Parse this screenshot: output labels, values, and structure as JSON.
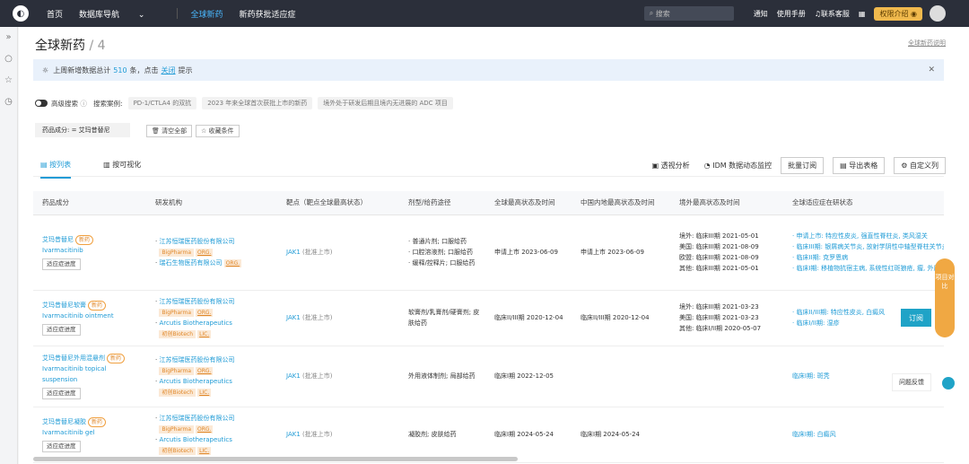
{
  "nav": {
    "home": "首页",
    "db_nav": "数据库导航",
    "global_new_drug": "全球新药",
    "new_drug_approval": "新药获批适应症"
  },
  "top": {
    "search_placeholder": "搜索",
    "notice": "通知",
    "manual": "使用手册",
    "contact": "联系客服",
    "perm": "权限介绍"
  },
  "page": {
    "title": "全球新药",
    "count": "/ 4",
    "help_link": "全球新药说明"
  },
  "banner": {
    "text_pre": "上周新增数据总计",
    "num": "510",
    "text_mid": "条，点击",
    "link": "关闭",
    "text_post": "提示"
  },
  "adv": {
    "label": "高级搜索",
    "cases_label": "搜索案例:",
    "chip1": "PD-1/CTLA4 的双抗",
    "chip2": "2023 年来全球首次获批上市的新药",
    "chip3": "境外处于研发后期且境内无进展的 ADC 项目"
  },
  "filter": {
    "text": "药品成分: = 艾玛昔替尼",
    "clear": "清空全部",
    "save": "收藏条件"
  },
  "tabs": {
    "list": "按列表",
    "visual": "按可视化"
  },
  "tools": {
    "analysis": "透视分析",
    "idm": "IDM 数据动态监控",
    "batch": "批量订阅",
    "export": "导出表格",
    "custom": "自定义列"
  },
  "columns": [
    "药品成分",
    "研发机构",
    "靶点（靶点全球最高状态）",
    "剂型/给药途径",
    "全球最高状态及时间",
    "中国内地最高状态及时间",
    "境外最高状态及时间",
    "全球适应症在研状态"
  ],
  "rows": [
    {
      "name": "艾玛昔替尼",
      "en": "Ivarmacitinib",
      "tag": "新药",
      "btn": "适应症进度",
      "org1": "江苏恒瑞医药股份有限公司",
      "o1a": "BigPharma",
      "o1b": "ORG.",
      "org2": "瑞石生物医药有限公司",
      "o2a": "ORG.",
      "target": "JAK1",
      "target_s": "(批准上市)",
      "form": "普通片剂; 口服给药",
      "form2": "口腔溶液剂; 口服给药",
      "form3": "缓释/控释片; 口服给药",
      "global": "申请上市 2023-06-09",
      "cn": "申请上市 2023-06-09",
      "ov1": "境外: 临床III期 2021-05-01",
      "ov2": "美国: 临床III期 2021-08-09",
      "ov3": "欧盟: 临床III期 2021-08-09",
      "ov4": "其他: 临床III期 2021-05-01",
      "ind1": "申请上市: 特应性皮炎, 强直性脊柱炎, 类风湿关",
      "ind2": "临床III期: 银屑病关节炎, 放射学阴性中轴型脊柱关节炎",
      "ind3": "临床II期: 克罗恩病",
      "ind4": "临床I期: 移植物抗宿主病, 系统性红斑狼疮, 瘤, 外周T细胞淋巴瘤"
    },
    {
      "name": "艾玛昔替尼软膏",
      "en": "Ivarmacitinib ointment",
      "tag": "新药",
      "btn": "适应症进度",
      "org1": "江苏恒瑞医药股份有限公司",
      "o1a": "BigPharma",
      "o1b": "ORG.",
      "org2": "Arcutis Biotherapeutics",
      "o2a": "初创Biotech",
      "o2b": "LIC.",
      "target": "JAK1",
      "target_s": "(批准上市)",
      "form": "软膏剂/乳膏剂/硬膏剂; 皮肤给药",
      "global": "临床II/III期 2020-12-04",
      "cn": "临床II/III期 2020-12-04",
      "ov1": "境外: 临床III期 2021-03-23",
      "ov2": "美国: 临床III期 2021-03-23",
      "ov3": "其他: 临床I/II期 2020-05-07",
      "ind1": "临床II/III期: 特应性皮炎, 白癜风",
      "ind2": "临床I/II期: 湿疹"
    },
    {
      "name": "艾玛昔替尼外用混悬剂",
      "en": "Ivarmacitinib topical suspension",
      "tag": "新药",
      "btn": "适应症进度",
      "org1": "江苏恒瑞医药股份有限公司",
      "o1a": "BigPharma",
      "o1b": "ORG.",
      "org2": "Arcutis Biotherapeutics",
      "o2a": "初创Biotech",
      "o2b": "LIC.",
      "target": "JAK1",
      "target_s": "(批准上市)",
      "form": "外用液体制剂; 局部给药",
      "global": "临床I期 2022-12-05",
      "cn": "",
      "ind1": "临床I期: 斑秃"
    },
    {
      "name": "艾玛昔替尼凝胶",
      "en": "Ivarmacitinib gel",
      "tag": "新药",
      "btn": "适应症进度",
      "org1": "江苏恒瑞医药股份有限公司",
      "o1a": "BigPharma",
      "o1b": "ORG.",
      "org2": "Arcutis Biotherapeutics",
      "o2a": "初创Biotech",
      "o2b": "LIC.",
      "target": "JAK1",
      "target_s": "(批准上市)",
      "form": "凝胶剂; 皮肤给药",
      "global": "临床I期 2024-05-24",
      "cn": "临床I期 2024-05-24",
      "ind1": "临床I期: 白癜风"
    }
  ],
  "float": {
    "compare": "项目对比",
    "subscribe": "订阅",
    "feedback": "问题反馈"
  }
}
